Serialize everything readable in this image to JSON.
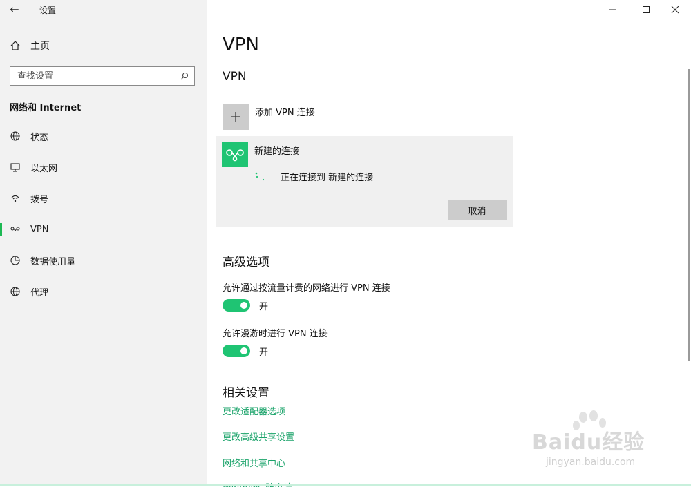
{
  "window": {
    "app_title": "设置"
  },
  "sidebar": {
    "home_label": "主页",
    "search_placeholder": "查找设置",
    "section_label": "网络和 Internet",
    "items": [
      {
        "label": "状态",
        "icon": "globe-status-icon"
      },
      {
        "label": "以太网",
        "icon": "ethernet-icon"
      },
      {
        "label": "拨号",
        "icon": "dialup-icon"
      },
      {
        "label": "VPN",
        "icon": "vpn-icon",
        "active": true
      },
      {
        "label": "数据使用量",
        "icon": "data-usage-icon"
      },
      {
        "label": "代理",
        "icon": "globe-proxy-icon"
      }
    ]
  },
  "main": {
    "page_title": "VPN",
    "vpn_heading": "VPN",
    "add_vpn_label": "添加 VPN 连接",
    "connection": {
      "name": "新建的连接",
      "status": "正在连接到 新建的连接",
      "cancel_label": "取消"
    },
    "advanced": {
      "heading": "高级选项",
      "option1_label": "允许通过按流量计费的网络进行 VPN 连接",
      "option1_state": "开",
      "option2_label": "允许漫游时进行 VPN 连接",
      "option2_state": "开"
    },
    "related": {
      "heading": "相关设置",
      "links": [
        "更改适配器选项",
        "更改高级共享设置",
        "网络和共享中心",
        "Windows 防火墙"
      ]
    }
  },
  "watermark": {
    "brand": "Baidu经验",
    "url": "jingyan.baidu.com"
  },
  "colors": {
    "accent": "#1fc473",
    "link": "#1aa36a",
    "sidebar_bg": "#f2f2f2"
  }
}
